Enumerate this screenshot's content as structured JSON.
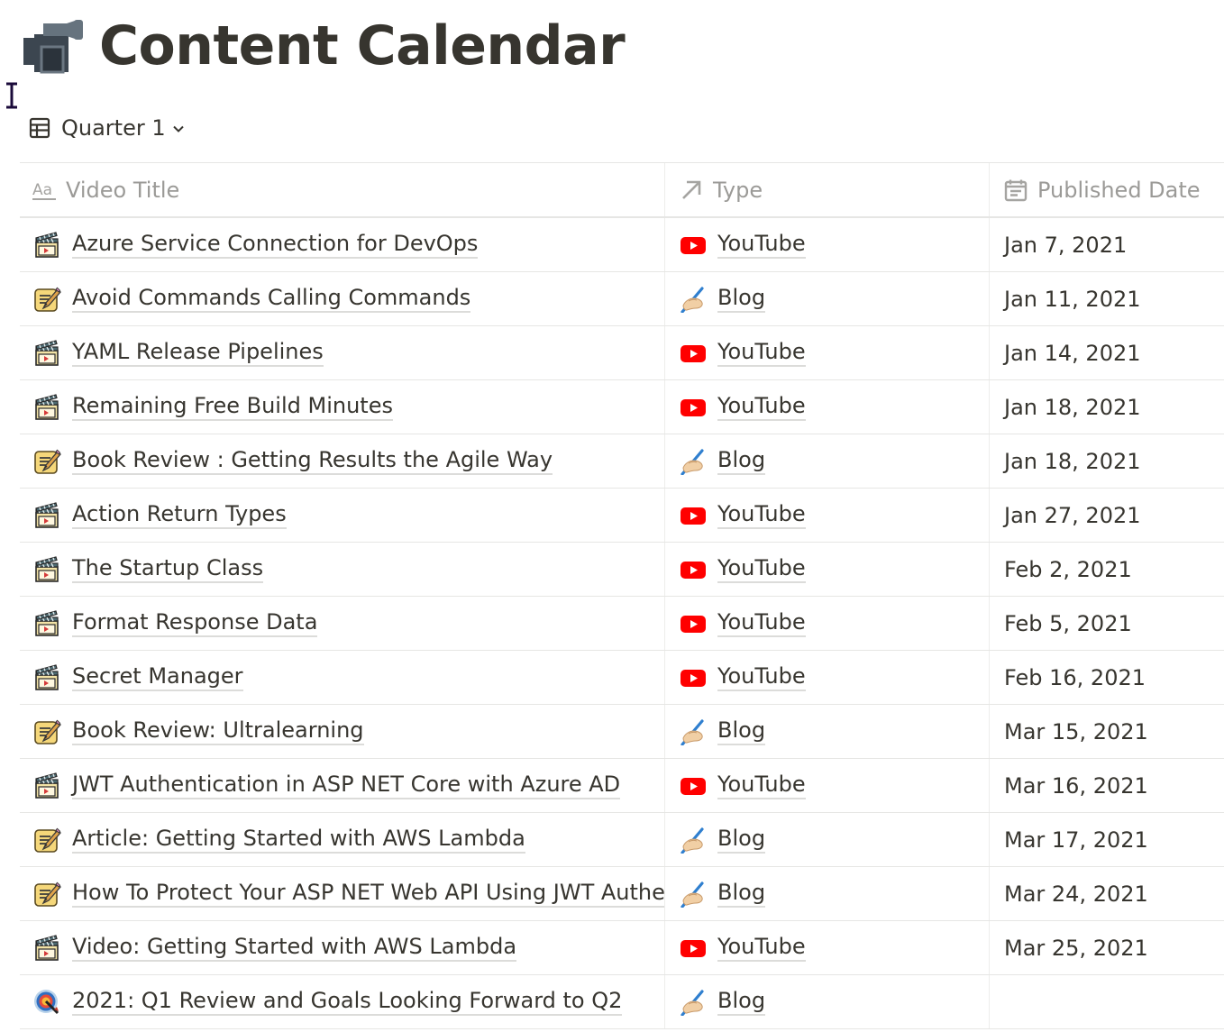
{
  "page": {
    "title": "Content Calendar",
    "title_icon": "movie-camera-icon"
  },
  "view": {
    "label": "Quarter 1",
    "icon": "table-icon",
    "dropdown_icon": "chevron-down-icon"
  },
  "table": {
    "columns": [
      {
        "label": "Video Title",
        "icon": "text-property-icon"
      },
      {
        "label": "Type",
        "icon": "relation-arrow-icon"
      },
      {
        "label": "Published Date",
        "icon": "calendar-icon"
      }
    ],
    "type_icons": {
      "YouTube": {
        "icon": "youtube-icon",
        "color": "#ff0000"
      },
      "Blog": {
        "icon": "writing-hand-icon",
        "color": "#3b82c4"
      }
    },
    "rows": [
      {
        "icon": "clapper-board-icon",
        "title": "Azure Service Connection for DevOps",
        "type": "YouTube",
        "date": "Jan 7, 2021"
      },
      {
        "icon": "memo-pencil-icon",
        "title": "Avoid Commands Calling Commands",
        "type": "Blog",
        "date": "Jan 11, 2021"
      },
      {
        "icon": "clapper-board-icon",
        "title": "YAML Release Pipelines",
        "type": "YouTube",
        "date": "Jan 14, 2021"
      },
      {
        "icon": "clapper-board-icon",
        "title": "Remaining Free Build Minutes",
        "type": "YouTube",
        "date": "Jan 18, 2021"
      },
      {
        "icon": "memo-pencil-icon",
        "title": "Book Review : Getting Results the Agile Way",
        "type": "Blog",
        "date": "Jan 18, 2021"
      },
      {
        "icon": "clapper-board-icon",
        "title": "Action Return Types",
        "type": "YouTube",
        "date": "Jan 27, 2021"
      },
      {
        "icon": "clapper-board-icon",
        "title": "The Startup Class",
        "type": "YouTube",
        "date": "Feb 2, 2021"
      },
      {
        "icon": "clapper-board-icon",
        "title": "Format Response Data",
        "type": "YouTube",
        "date": "Feb 5, 2021"
      },
      {
        "icon": "clapper-board-icon",
        "title": "Secret Manager",
        "type": "YouTube",
        "date": "Feb 16, 2021"
      },
      {
        "icon": "memo-pencil-icon",
        "title": "Book Review: Ultralearning",
        "type": "Blog",
        "date": "Mar 15, 2021"
      },
      {
        "icon": "clapper-board-icon",
        "title": "JWT Authentication in ASP NET Core with Azure AD",
        "type": "YouTube",
        "date": "Mar 16, 2021"
      },
      {
        "icon": "memo-pencil-icon",
        "title": "Article: Getting Started with AWS Lambda",
        "type": "Blog",
        "date": "Mar 17, 2021"
      },
      {
        "icon": "memo-pencil-icon",
        "title": "How To Protect Your ASP NET Web API Using JWT Authentication",
        "type": "Blog",
        "date": "Mar 24, 2021"
      },
      {
        "icon": "clapper-board-icon",
        "title": "Video: Getting Started with AWS Lambda",
        "type": "YouTube",
        "date": "Mar 25, 2021"
      },
      {
        "icon": "direct-hit-target-icon",
        "title": "2021: Q1 Review and Goals Looking Forward to Q2",
        "type": "Blog",
        "date": ""
      }
    ]
  }
}
